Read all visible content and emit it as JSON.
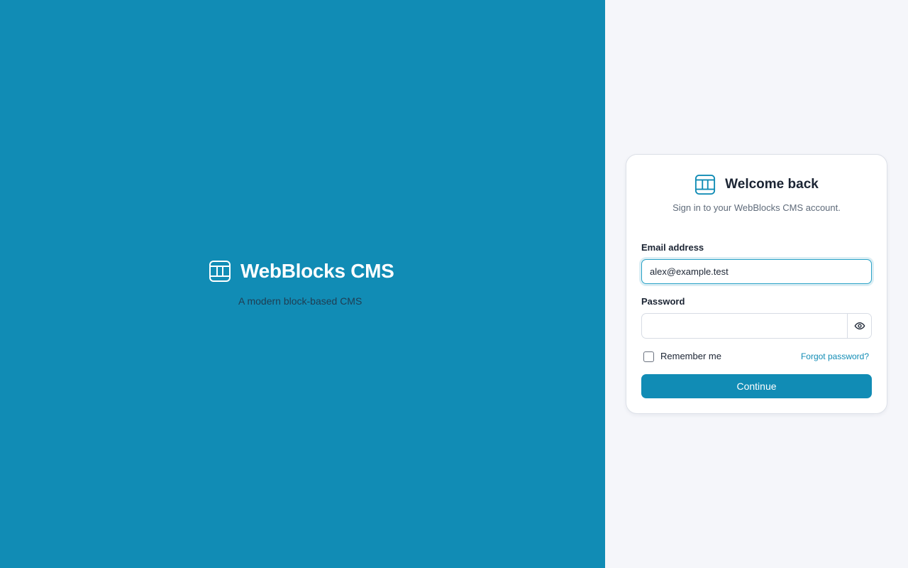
{
  "brand": {
    "name": "WebBlocks CMS",
    "tagline": "A modern block-based CMS",
    "icon": "layout-blocks-icon"
  },
  "colors": {
    "accent": "#118cb5",
    "left_panel_bg": "#118cb5",
    "page_bg": "#f5f6fa",
    "text_dark": "#1b2433"
  },
  "login": {
    "title": "Welcome back",
    "subtitle": "Sign in to your WebBlocks CMS account.",
    "email": {
      "label": "Email address",
      "value": "alex@example.test"
    },
    "password": {
      "label": "Password",
      "value": "",
      "toggle_icon": "eye-icon"
    },
    "remember_me": {
      "label": "Remember me",
      "checked": false
    },
    "forgot_password": "Forgot password?",
    "submit_label": "Continue"
  }
}
